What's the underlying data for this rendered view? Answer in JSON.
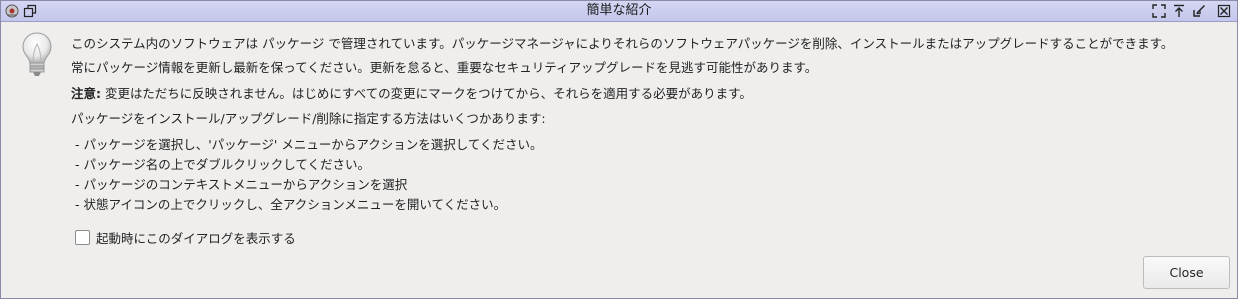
{
  "window": {
    "title": "簡単な紹介"
  },
  "icons": {
    "app": "app-menu-icon",
    "restore": "window-restore-icon",
    "fullscreen": "fullscreen-icon",
    "keep_above": "keep-above-icon",
    "minimize": "minimize-icon",
    "close": "close-window-icon",
    "bulb": "lightbulb-icon"
  },
  "body": {
    "para1": "このシステム内のソフトウェアは パッケージ で管理されています。パッケージマネージャによりそれらのソフトウェアパッケージを削除、インストールまたはアップグレードすることができます。",
    "para2": "常にパッケージ情報を更新し最新を保ってください。更新を怠ると、重要なセキュリティアップグレードを見逃す可能性があります。",
    "note_label": "注意:",
    "note_text": " 変更はただちに反映されません。はじめにすべての変更にマークをつけてから、それらを適用する必要があります。",
    "para4": "パッケージをインストール/アップグレード/削除に指定する方法はいくつかあります:",
    "methods": [
      "-  パッケージを選択し、'パッケージ' メニューからアクションを選択してください。",
      "-  パッケージ名の上でダブルクリックしてください。",
      "-  パッケージのコンテキストメニューからアクションを選択",
      "-  状態アイコンの上でクリックし、全アクションメニューを開いてください。"
    ]
  },
  "startup_checkbox": {
    "label": "起動時にこのダイアログを表示する",
    "checked": false
  },
  "buttons": {
    "close_label": "Close"
  }
}
